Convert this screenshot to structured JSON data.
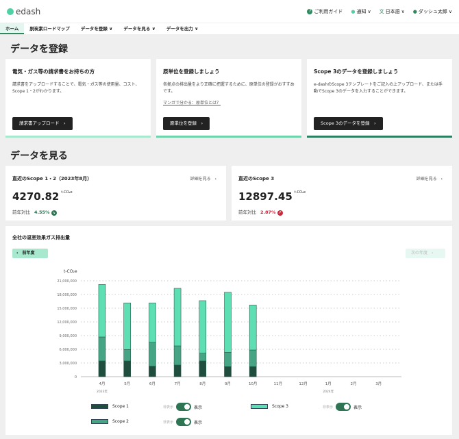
{
  "header": {
    "brand": "edash",
    "guide": "ご利用ガイド",
    "notify": "通知",
    "language": "日本語",
    "user": "ダッシュ太郎"
  },
  "nav": [
    "ホーム",
    "脱炭素ロードマップ",
    "データを登録 ∨",
    "データを見る ∨",
    "データを出力 ∨"
  ],
  "register": {
    "title": "データを登録",
    "cards": [
      {
        "title": "電気・ガス等の請求書をお持ちの方",
        "desc": "請求書をアップロードすることで、電気・ガス等の使用量、コスト、Scope 1・2がわかります。",
        "button": "請求書アップロード　›",
        "color": "#a7e8cf"
      },
      {
        "title": "原単位を登録しましょう",
        "desc": "各拠点の排出量をより正確に把握するために、原単位の登録がおすすめです。",
        "link": "マンガで分かる：原単位とは？",
        "button": "原単位を登録　›",
        "color": "#6fd3ac"
      },
      {
        "title": "Scope 3のデータを登録しましょう",
        "desc": "e-dashのScope 3テンプレートをご記入の上アップロード、または手動でScope 3のデータを入力することができます。",
        "button": "Scope 3のデータを登録　›",
        "color": "#2e7f5f"
      }
    ]
  },
  "view": {
    "title": "データを見る",
    "kpi": [
      {
        "title": "直近のScope 1・2（2023年8月）",
        "more": "詳細を見る　›",
        "value": "4270.82",
        "unit": "t-CO₂e",
        "yoy_label": "前年対比",
        "yoy": "4.55%",
        "color": "#2e7554",
        "icon": "↘"
      },
      {
        "title": "直近のScope 3",
        "more": "詳細を見る　›",
        "value": "12897.45",
        "unit": "t-CO₂e",
        "yoy_label": "前年対比",
        "yoy": "2.87%",
        "color": "#c8283c",
        "icon": "↗"
      }
    ]
  },
  "chart_card": {
    "title": "全社の温室効果ガス排出量",
    "prev": "‹　前年度",
    "next": "次の年度　›",
    "hide": "非表示",
    "show": "表示"
  },
  "chart_data": {
    "type": "bar",
    "stacked": true,
    "ylabel": "t-CO₂e",
    "ylim": [
      0,
      21000000
    ],
    "yticks": [
      "0",
      "3,000,000",
      "6,000,000",
      "9,000,000",
      "12,000,000",
      "15,000,000",
      "18,000,000",
      "21,000,000"
    ],
    "categories": [
      "4月",
      "5月",
      "6月",
      "7月",
      "8月",
      "9月",
      "10月",
      "11月",
      "12月",
      "1月",
      "2月",
      "3月"
    ],
    "year_labels": [
      "2023年",
      "2024年"
    ],
    "series": [
      {
        "name": "Scope 1",
        "color": "#1f4d3e",
        "values": [
          3450000,
          3450000,
          2300000,
          2550000,
          3450000,
          2200000,
          2200000,
          null,
          null,
          null,
          null,
          null
        ]
      },
      {
        "name": "Scope 2",
        "color": "#45a585",
        "values": [
          5250000,
          2500000,
          5250000,
          4200000,
          1700000,
          3150000,
          3650000,
          null,
          null,
          null,
          null,
          null
        ]
      },
      {
        "name": "Scope 3",
        "color": "#5ddfb3",
        "values": [
          11500000,
          10200000,
          8600000,
          12600000,
          11500000,
          13150000,
          9850000,
          null,
          null,
          null,
          null,
          null
        ]
      }
    ]
  }
}
